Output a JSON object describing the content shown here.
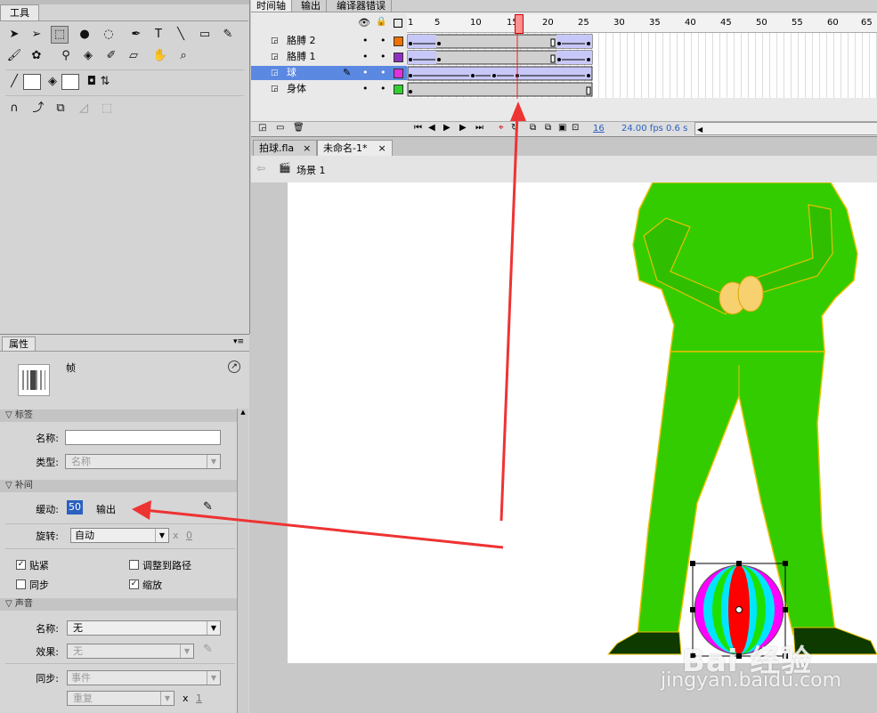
{
  "tools_panel": {
    "title": "工具",
    "icons": [
      "selection-arrow-icon",
      "subselect-arrow-icon",
      "free-transform-icon",
      "3d-rotation-icon",
      "lasso-icon",
      "pen-icon",
      "text-tool-icon",
      "line-tool-icon",
      "rectangle-tool-icon",
      "pencil-icon",
      "brush-icon",
      "deco-icon",
      "bone-icon",
      "paint-bucket-icon",
      "eyedropper-icon",
      "eraser-icon",
      "hand-icon",
      "zoom-icon",
      "stroke-color-icon",
      "fill-color-icon",
      "swap-colors-icon",
      "snap-magnet-icon",
      "smooth-icon",
      "straighten-icon"
    ],
    "text_glyph": "T"
  },
  "timeline": {
    "tabs": [
      "时间轴",
      "输出",
      "编译器错误"
    ],
    "ruler": [
      "1",
      "5",
      "10",
      "15",
      "20",
      "25",
      "30",
      "35",
      "40",
      "45",
      "50",
      "55",
      "60",
      "65"
    ],
    "layers": [
      {
        "name": "胳膊 2",
        "color": "#f07000",
        "selected": false
      },
      {
        "name": "胳膊 1",
        "color": "#9030c0",
        "selected": false
      },
      {
        "name": "球",
        "color": "#e030e0",
        "selected": true
      },
      {
        "name": "身体",
        "color": "#30d030",
        "selected": false
      }
    ],
    "current_frame": "16",
    "fps": "24.00 fps",
    "time": "0.6 s"
  },
  "documents": {
    "tabs": [
      "拍球.fla",
      "未命名-1*"
    ],
    "close_glyph": "×",
    "scene": "场景 1"
  },
  "properties": {
    "tab": "属性",
    "type_label": "帧",
    "section_label": "标签",
    "name_label": "名称:",
    "name_value": "",
    "type_field_label": "类型:",
    "type_value": "名称",
    "section_tween": "补间",
    "ease_label": "缓动:",
    "ease_value": "50",
    "ease_output": "输出",
    "rotate_label": "旋转:",
    "rotate_value": "自动",
    "rotate_times": "x",
    "rotate_count": "0",
    "cb_snap": "贴紧",
    "cb_snap_checked": true,
    "cb_orient": "调整到路径",
    "cb_orient_checked": false,
    "cb_sync": "同步",
    "cb_sync_checked": false,
    "cb_scale": "缩放",
    "cb_scale_checked": true,
    "section_sound": "声音",
    "sound_name_label": "名称:",
    "sound_name_value": "无",
    "effect_label": "效果:",
    "effect_value": "无",
    "sync_label": "同步:",
    "sync_value": "事件",
    "repeat_value": "重复",
    "repeat_times": "x",
    "repeat_count": "1"
  },
  "watermark": {
    "logo": "Bai 经验",
    "url": "jingyan.baidu.com"
  },
  "colors": {
    "figure_green": "#33cc00",
    "outline": "#e8c000",
    "selection": "#c0c0ff",
    "annotation_arrow": "#ee3333"
  }
}
